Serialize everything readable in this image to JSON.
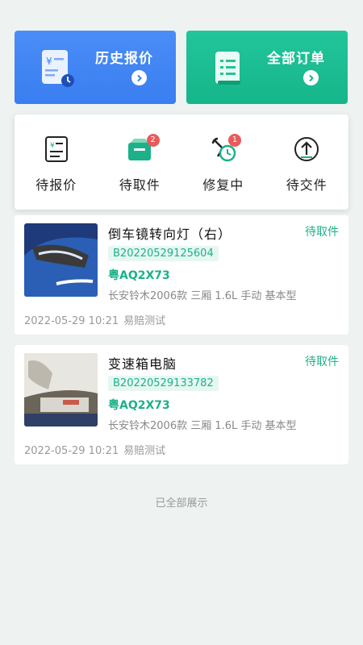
{
  "top_cards": [
    {
      "title": "历史报价",
      "icon": "quote-history-icon",
      "color": "#3b82f6"
    },
    {
      "title": "全部订单",
      "icon": "order-list-icon",
      "color": "#1bb58a"
    }
  ],
  "status_tabs": [
    {
      "label": "待报价",
      "icon": "pending-quote-icon",
      "badge": null
    },
    {
      "label": "待取件",
      "icon": "pending-pickup-icon",
      "badge": "2"
    },
    {
      "label": "修复中",
      "icon": "repairing-icon",
      "badge": "1"
    },
    {
      "label": "待交件",
      "icon": "pending-delivery-icon",
      "badge": null
    }
  ],
  "orders": [
    {
      "title": "倒车镜转向灯（右）",
      "status": "待取件",
      "code": "B20220529125604",
      "plate": "粤AQ2X73",
      "model": "长安铃木2006款 三厢 1.6L 手动 基本型",
      "datetime": "2022-05-29 10:21",
      "user": "易赔测试"
    },
    {
      "title": "变速箱电脑",
      "status": "待取件",
      "code": "B20220529133782",
      "plate": "粤AQ2X73",
      "model": "长安铃木2006款 三厢 1.6L 手动 基本型",
      "datetime": "2022-05-29 10:21",
      "user": "易赔测试"
    }
  ],
  "footer": "已全部展示",
  "colors": {
    "accent_green": "#1bb18a",
    "accent_blue": "#3b82f6",
    "badge_red": "#e95b5b"
  }
}
